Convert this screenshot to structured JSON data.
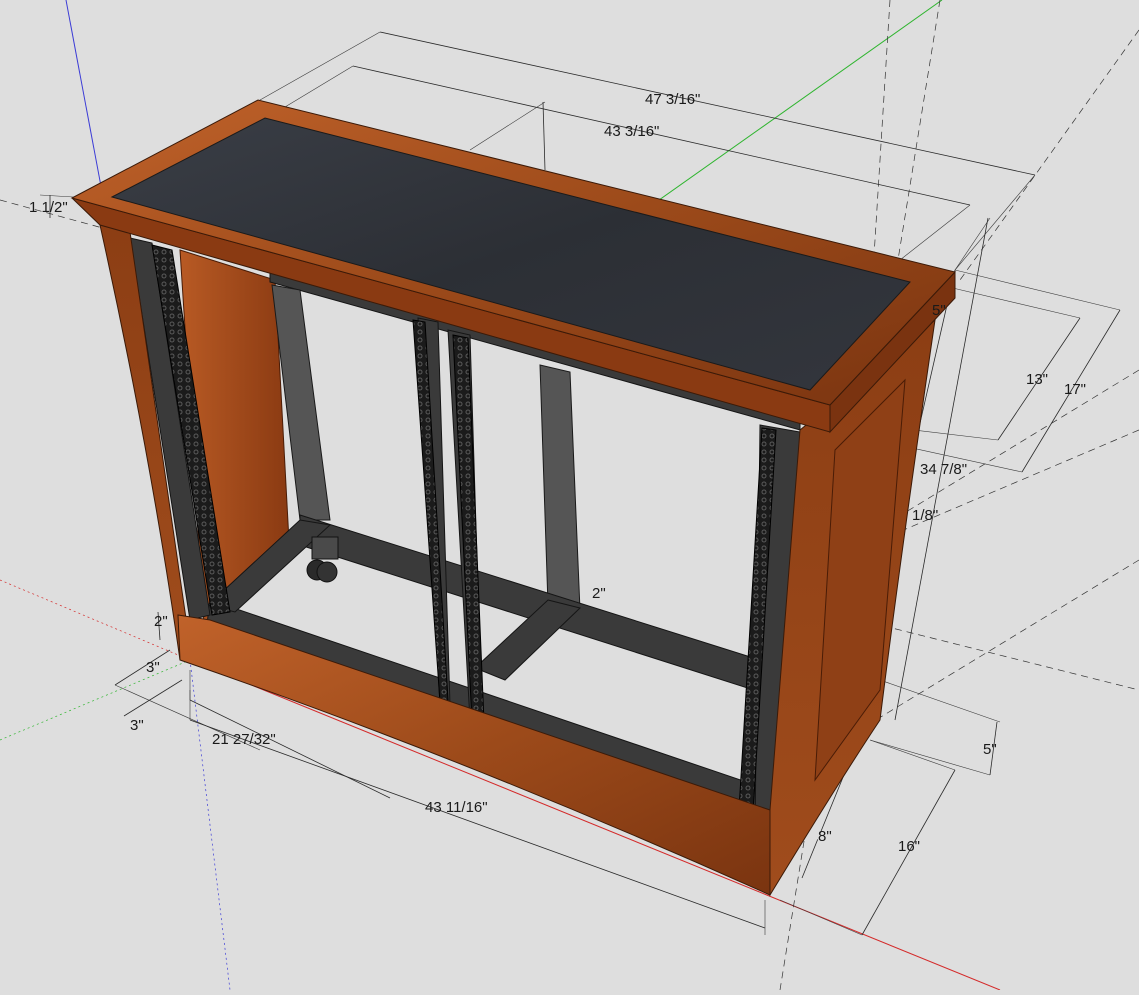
{
  "dimensions": {
    "overall_width": "47 3/16\"",
    "inner_width": "43 3/16\"",
    "top_thickness": "1 1/2\"",
    "depth_13": "13\"",
    "depth_17": "17\"",
    "height": "34 7/8\"",
    "partial_18": "1/8\"",
    "top_edge_partial": "5\"",
    "shelf_partial": "2\"",
    "base_2": "2\"",
    "base_3_a": "3\"",
    "base_3_b": "3\"",
    "half_width": "21 27/32\"",
    "front_width": "43 11/16\"",
    "leg_5": "5\"",
    "leg_16": "16\"",
    "leg_8": "8\""
  },
  "colors": {
    "background": "#dedede",
    "wood": "#a24e1c",
    "wood_dark": "#6e2e0d",
    "felt_top": "#2f3238",
    "steel": "#3a3a3a",
    "axis_red": "#d42a2a",
    "axis_green": "#2fb52f",
    "axis_blue": "#3b3bd6"
  }
}
